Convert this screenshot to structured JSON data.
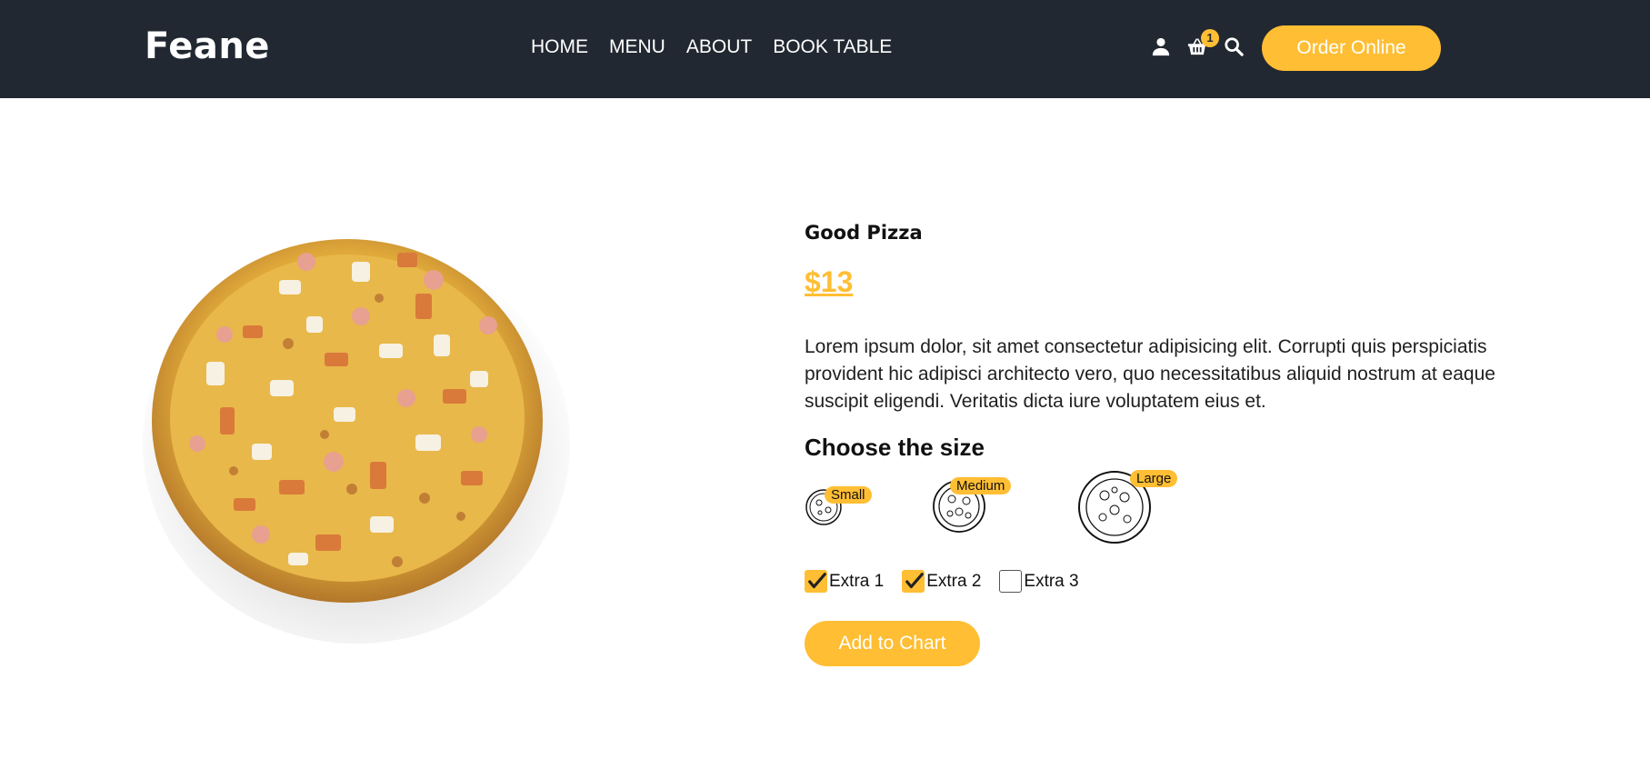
{
  "header": {
    "logo": "Feane",
    "nav": [
      "HOME",
      "MENU",
      "ABOUT",
      "BOOK TABLE"
    ],
    "cart_count": "1",
    "order_button": "Order Online"
  },
  "product": {
    "name": "Good Pizza",
    "price": "$13",
    "description": "Lorem ipsum dolor, sit amet consectetur adipisicing elit. Corrupti quis perspiciatis provident hic adipisci architecto vero, quo necessitatibus aliquid nostrum at eaque suscipit eligendi. Veritatis dicta iure voluptatem eius et.",
    "size_title": "Choose the size",
    "sizes": [
      "Small",
      "Medium",
      "Large"
    ],
    "extras": [
      {
        "label": "Extra 1",
        "checked": true
      },
      {
        "label": "Extra 2",
        "checked": true
      },
      {
        "label": "Extra 3",
        "checked": false
      }
    ],
    "add_button": "Add to Chart"
  },
  "colors": {
    "header_bg": "#222831",
    "accent": "#ffbe33"
  },
  "icons": [
    "user-icon",
    "shopping-basket-icon",
    "search-icon",
    "pizza-icon",
    "check-icon"
  ]
}
